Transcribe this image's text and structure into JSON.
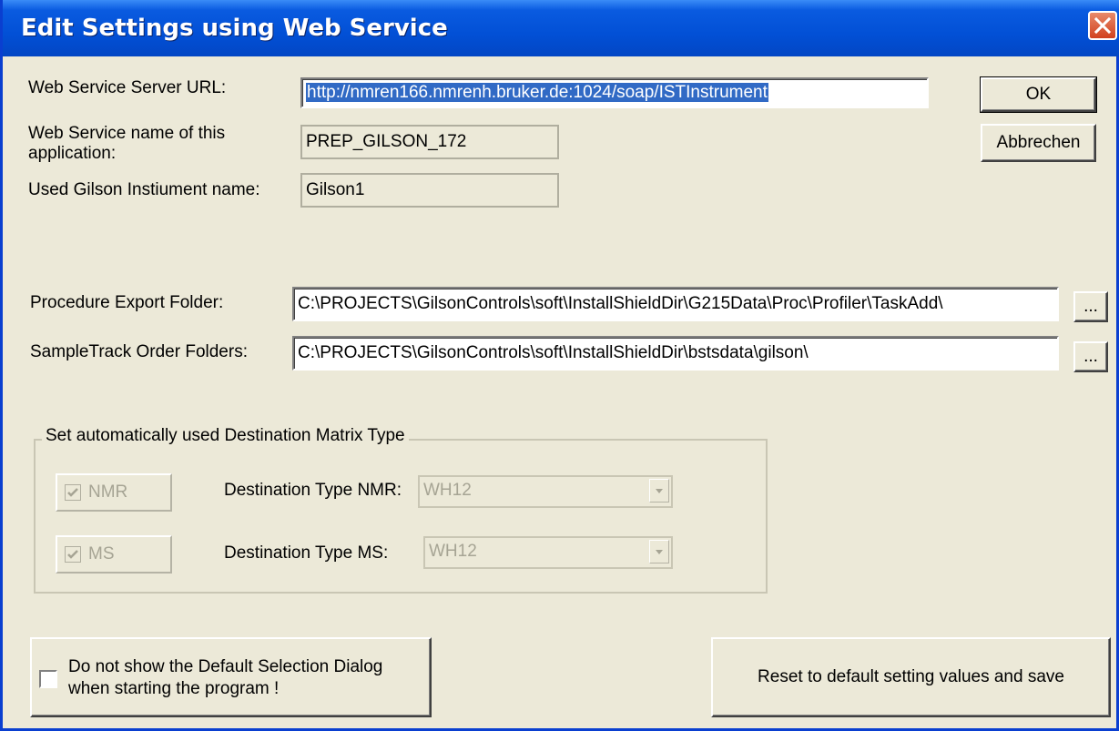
{
  "window": {
    "title": "Edit Settings using Web Service"
  },
  "fields": {
    "server_url_label": "Web Service Server URL:",
    "server_url_value": "http://nmren166.nmrenh.bruker.de:1024/soap/ISTInstrument",
    "app_name_label_line1": "Web Service name of this",
    "app_name_label_line2": "application:",
    "app_name_value": "PREP_GILSON_172",
    "instrument_label": "Used Gilson Instiument name:",
    "instrument_value": "Gilson1",
    "export_folder_label": "Procedure Export Folder:",
    "export_folder_value": "C:\\PROJECTS\\GilsonControls\\soft\\InstallShieldDir\\G215Data\\Proc\\Profiler\\TaskAdd\\",
    "order_folders_label": "SampleTrack Order Folders:",
    "order_folders_value": "C:\\PROJECTS\\GilsonControls\\soft\\InstallShieldDir\\bstsdata\\gilson\\"
  },
  "buttons": {
    "ok": "OK",
    "cancel": "Abbrechen",
    "browse": "...",
    "reset": "Reset to default setting values and save"
  },
  "matrix": {
    "group_title": "Set automatically used Destination Matrix Type",
    "nmr_check": "NMR",
    "nmr_type_label": "Destination Type NMR:",
    "nmr_type_value": "WH12",
    "ms_check": "MS",
    "ms_type_label": "Destination Type MS:",
    "ms_type_value": "WH12"
  },
  "options": {
    "no_dialog_line1": "Do not show the Default Selection Dialog",
    "no_dialog_line2": "when starting the program !"
  }
}
